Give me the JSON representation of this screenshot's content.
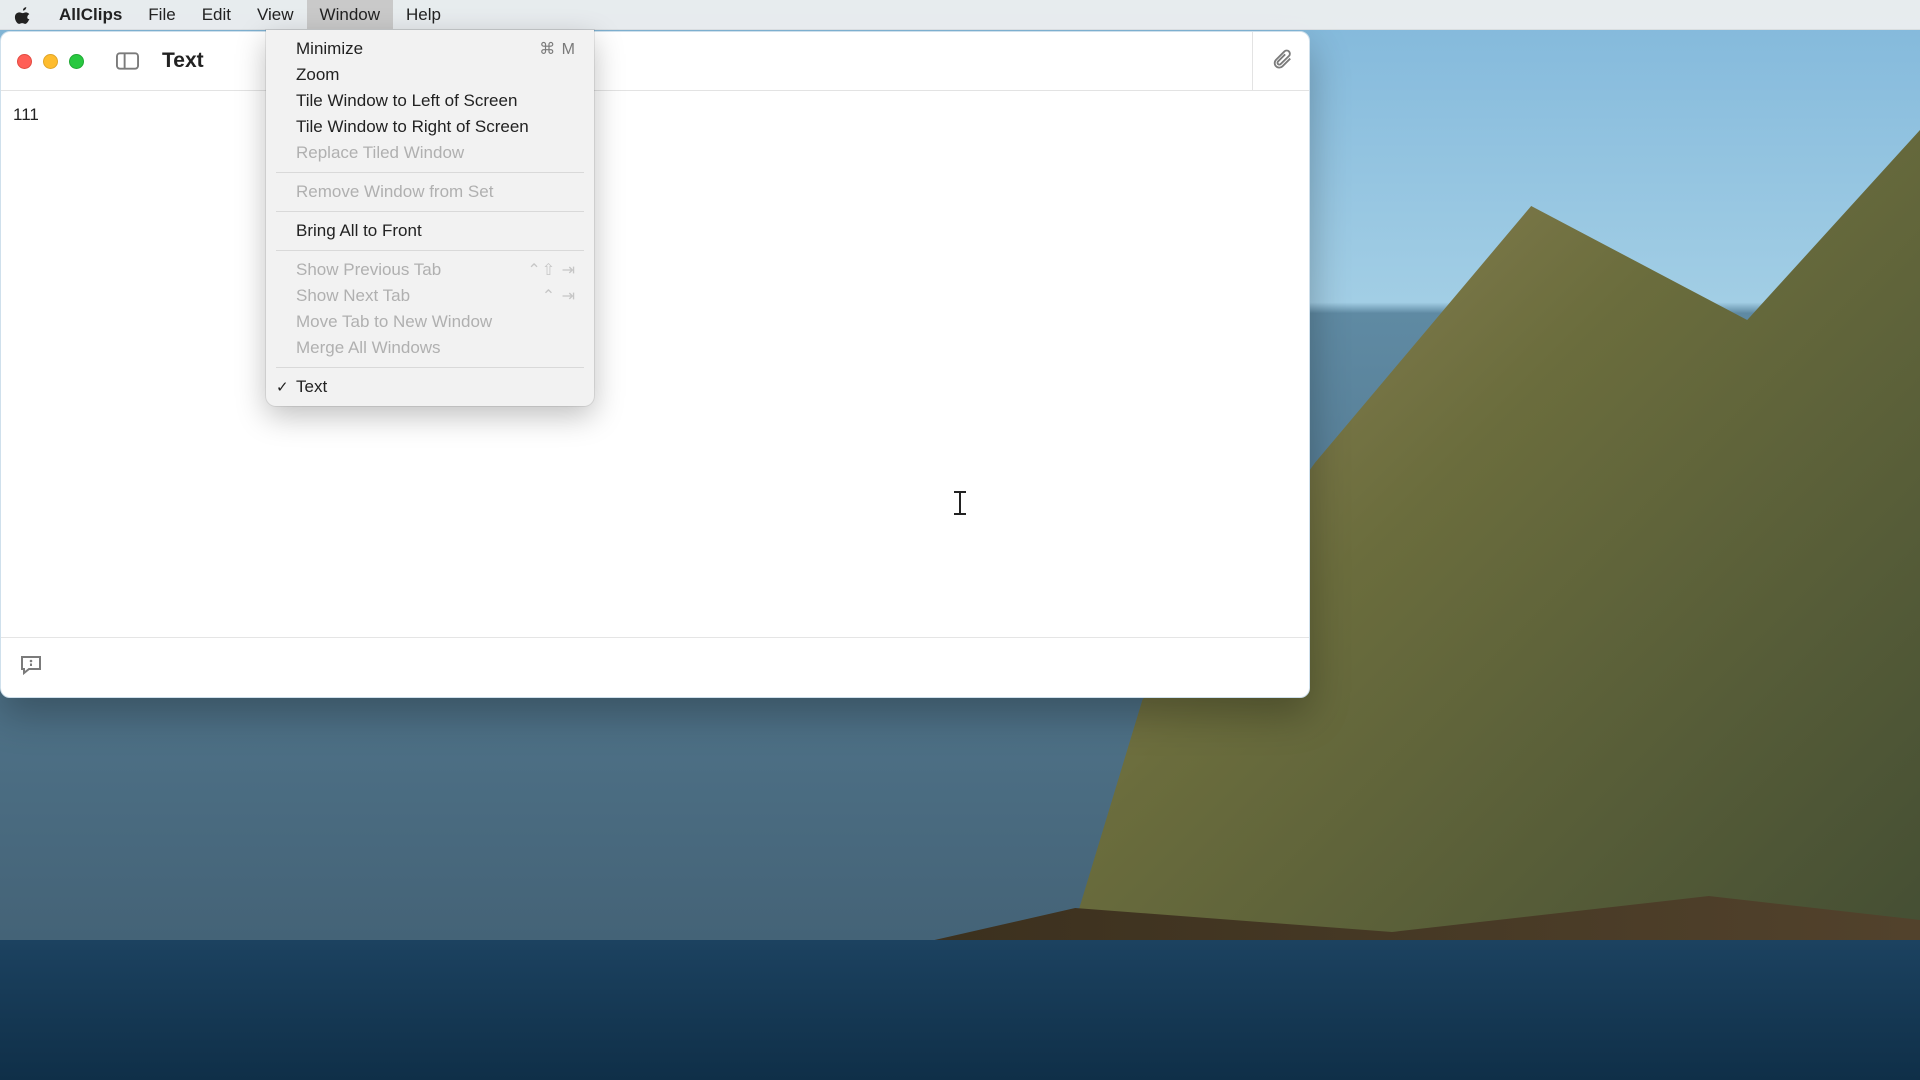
{
  "menubar": {
    "app_name": "AllClips",
    "items": {
      "file": "File",
      "edit": "Edit",
      "view": "View",
      "window": "Window",
      "help": "Help"
    }
  },
  "dropdown": {
    "minimize": "Minimize",
    "minimize_shortcut": "⌘ M",
    "zoom": "Zoom",
    "tile_left": "Tile Window to Left of Screen",
    "tile_right": "Tile Window to Right of Screen",
    "replace_tiled": "Replace Tiled Window",
    "remove_from_set": "Remove Window from Set",
    "bring_front": "Bring All to Front",
    "show_prev_tab": "Show Previous Tab",
    "show_prev_tab_shortcut": "⌃⇧ ⇥",
    "show_next_tab": "Show Next Tab",
    "show_next_tab_shortcut": "⌃ ⇥",
    "move_tab_new": "Move Tab to New Window",
    "merge_all": "Merge All Windows",
    "window_entry": "Text",
    "checkmark": "✓"
  },
  "window": {
    "title": "Text",
    "content_text": "111"
  }
}
